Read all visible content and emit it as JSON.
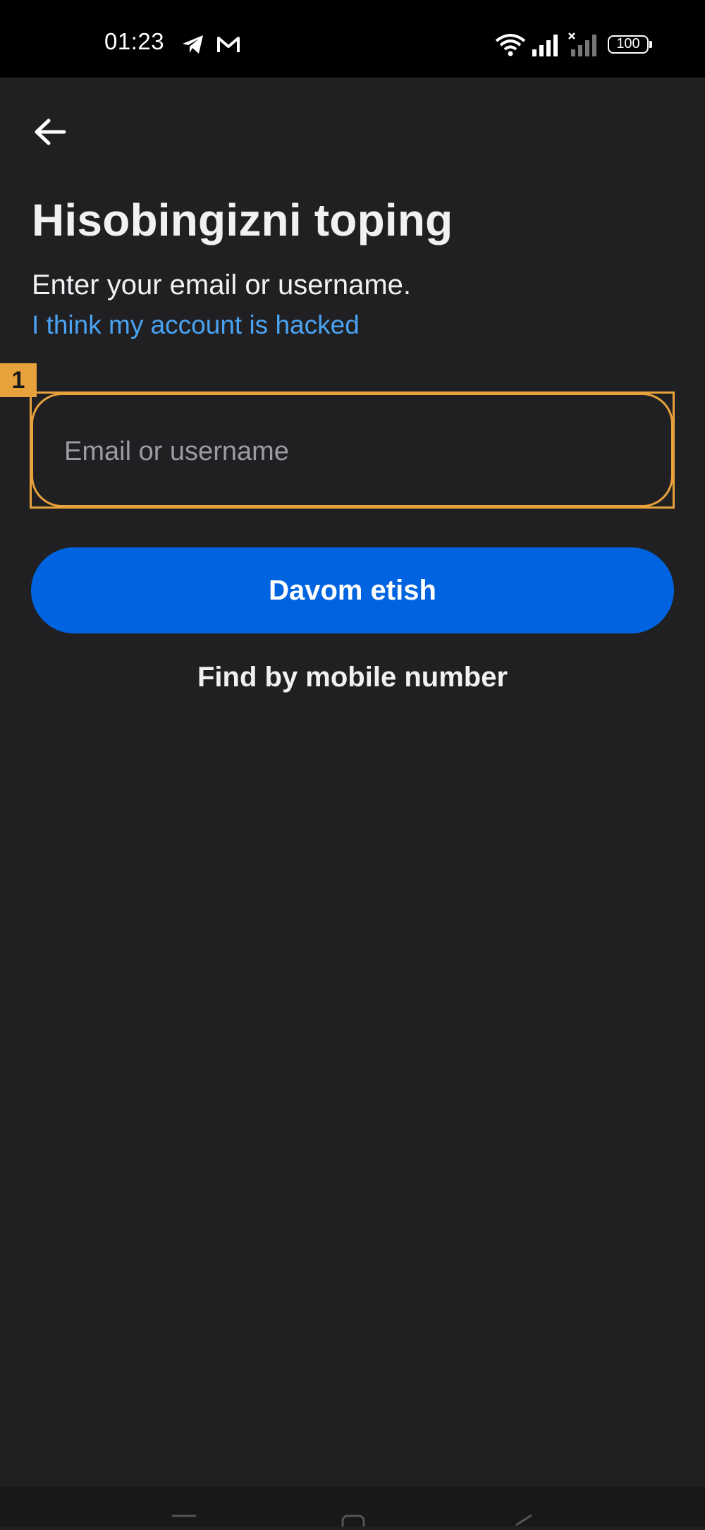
{
  "status_bar": {
    "time": "01:23",
    "icons": [
      "telegram-icon",
      "gmail-icon",
      "wifi-icon",
      "signal-icon",
      "signal-no-sim-icon"
    ],
    "battery": "100"
  },
  "header": {
    "back_icon": "arrow-left-icon"
  },
  "main": {
    "title": "Hisobingizni toping",
    "subtitle": "Enter your email or username.",
    "hacked_link": "I think my account is hacked",
    "search_input": {
      "value": "",
      "placeholder": "Email or username"
    },
    "marker_label": "1",
    "continue_button": "Davom etish",
    "find_by_mobile": "Find by mobile number"
  },
  "nav_bar": {
    "icons": [
      "menu-icon",
      "home-icon",
      "back-triangle-icon"
    ]
  },
  "colors": {
    "background": "#202023",
    "accent": "#0064e0",
    "link": "#4aa3f2",
    "highlight": "#e8a23c"
  }
}
